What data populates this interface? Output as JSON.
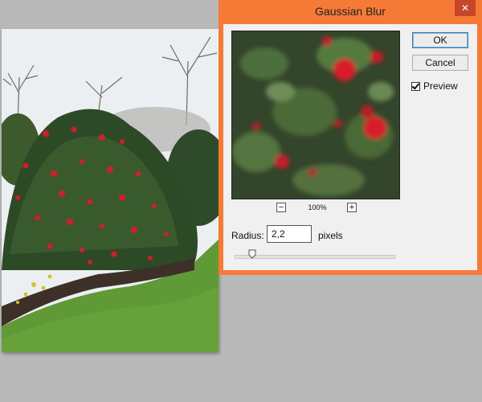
{
  "dialog": {
    "title": "Gaussian Blur",
    "close_glyph": "✕",
    "ok_label": "OK",
    "cancel_label": "Cancel",
    "preview_label": "Preview",
    "preview_checked": true,
    "zoom_out": "−",
    "zoom_in": "+",
    "zoom_level": "100%",
    "radius_label": "Radius:",
    "radius_value": "2,2",
    "radius_unit": "pixels",
    "slider_level_fraction": 0.11
  },
  "colors": {
    "dialog_frame": "#f47a36",
    "close_button": "#c7462b",
    "flower_red": "#d81f2a",
    "foliage": "#2d4a26",
    "lawn": "#5f9a36"
  }
}
